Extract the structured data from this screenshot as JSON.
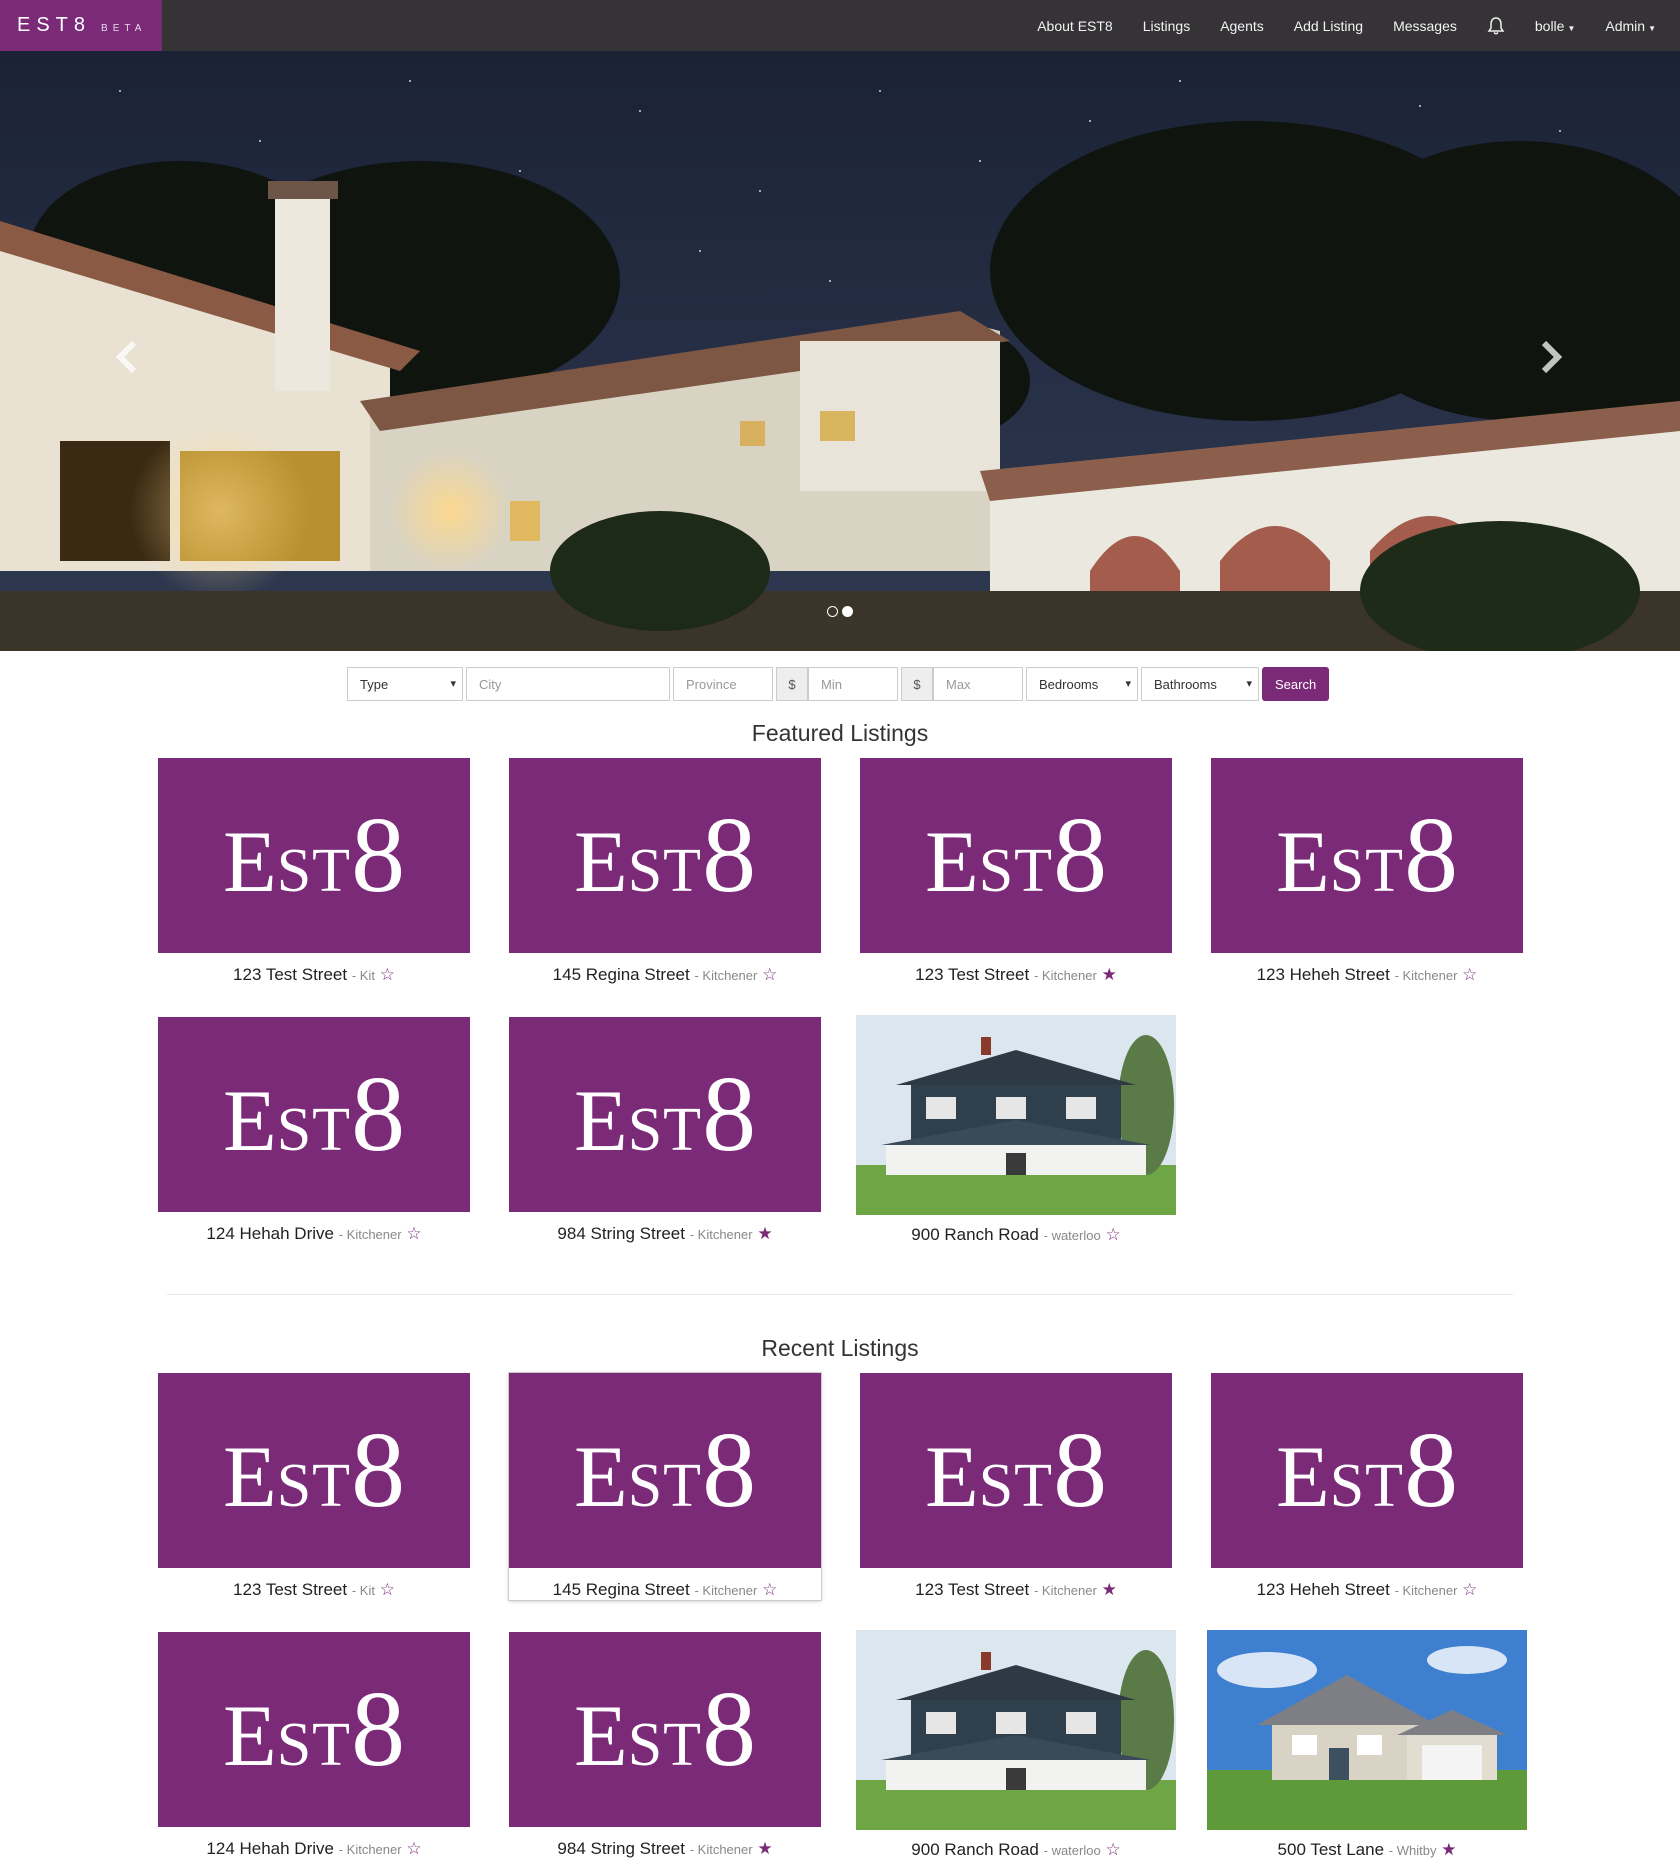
{
  "brand": {
    "name": "EST8",
    "tag": "BETA"
  },
  "nav": {
    "items": [
      "About EST8",
      "Listings",
      "Agents",
      "Add Listing",
      "Messages"
    ],
    "user": "bolle",
    "admin": "Admin"
  },
  "carousel": {
    "slides": 2,
    "active_slide": 2
  },
  "search": {
    "type": "Type",
    "city_placeholder": "City",
    "province_placeholder": "Province",
    "currency": "$",
    "min_placeholder": "Min",
    "max_placeholder": "Max",
    "bedrooms": "Bedrooms",
    "bathrooms": "Bathrooms",
    "button": "Search"
  },
  "logo_text": {
    "e": "E",
    "st": "ST",
    "eight": "8"
  },
  "featured": {
    "title": "Featured Listings",
    "listings": [
      {
        "address": "123 Test Street",
        "city": "- Kit",
        "star": "☆"
      },
      {
        "address": "145 Regina Street",
        "city": "- Kitchener",
        "star": "☆"
      },
      {
        "address": "123 Test Street",
        "city": "- Kitchener",
        "star": "★"
      },
      {
        "address": "123 Heheh Street",
        "city": "- Kitchener",
        "star": "☆"
      },
      {
        "address": "124 Hehah Drive",
        "city": "- Kitchener",
        "star": "☆"
      },
      {
        "address": "984 String Street",
        "city": "- Kitchener",
        "star": "★"
      },
      {
        "address": "900 Ranch Road",
        "city": "- waterloo",
        "star": "☆"
      }
    ]
  },
  "recent": {
    "title": "Recent Listings",
    "listings": [
      {
        "address": "123 Test Street",
        "city": "- Kit",
        "star": "☆"
      },
      {
        "address": "145 Regina Street",
        "city": "- Kitchener",
        "star": "☆"
      },
      {
        "address": "123 Test Street",
        "city": "- Kitchener",
        "star": "★"
      },
      {
        "address": "123 Heheh Street",
        "city": "- Kitchener",
        "star": "☆"
      },
      {
        "address": "124 Hehah Drive",
        "city": "- Kitchener",
        "star": "☆"
      },
      {
        "address": "984 String Street",
        "city": "- Kitchener",
        "star": "★"
      },
      {
        "address": "900 Ranch Road",
        "city": "- waterloo",
        "star": "☆"
      },
      {
        "address": "500 Test Lane",
        "city": "- Whitby",
        "star": "★"
      }
    ]
  },
  "colors": {
    "brand": "#7b2a78",
    "navbar": "#353336"
  }
}
